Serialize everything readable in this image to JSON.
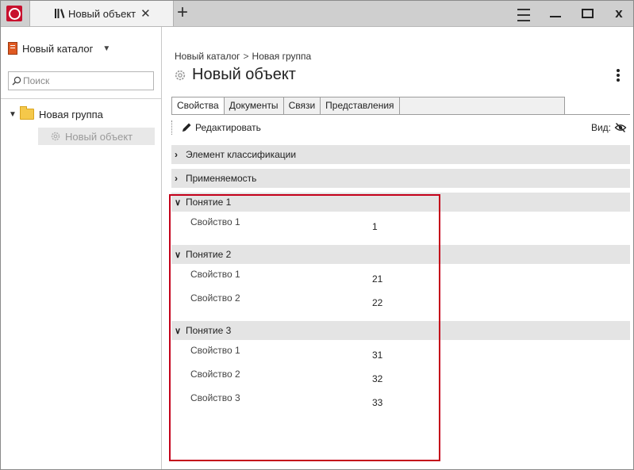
{
  "titlebar": {
    "tab_title": "Новый объект",
    "tab_close": "✕",
    "new_tab": "+",
    "close_label": "x"
  },
  "left": {
    "catalog_label": "Новый каталог",
    "search_placeholder": "Поиск",
    "tree": {
      "group_label": "Новая группа",
      "object_label": "Новый объект"
    }
  },
  "content": {
    "breadcrumb": {
      "catalog": "Новый каталог",
      "separator": ">",
      "group": "Новая группа"
    },
    "title": "Новый объект",
    "tabs": [
      "Свойства",
      "Документы",
      "Связи",
      "Представления"
    ],
    "toolbar": {
      "edit_label": "Редактировать",
      "view_label": "Вид:"
    },
    "sections": [
      {
        "label": "Элемент классификации"
      },
      {
        "label": "Применяемость"
      }
    ],
    "concepts": [
      {
        "label": "Понятие 1",
        "properties": [
          {
            "name": "Свойство 1",
            "value": "1"
          }
        ]
      },
      {
        "label": "Понятие 2",
        "properties": [
          {
            "name": "Свойство 1",
            "value": "21"
          },
          {
            "name": "Свойство 2",
            "value": "22"
          }
        ]
      },
      {
        "label": "Понятие 3",
        "properties": [
          {
            "name": "Свойство 1",
            "value": "31"
          },
          {
            "name": "Свойство 2",
            "value": "32"
          },
          {
            "name": "Свойство 3",
            "value": "33"
          }
        ]
      }
    ]
  },
  "colors": {
    "brand": "#c8102e",
    "highlight": "#c4001a",
    "section_bg": "#e4e4e4",
    "folder": "#f5c84a"
  }
}
